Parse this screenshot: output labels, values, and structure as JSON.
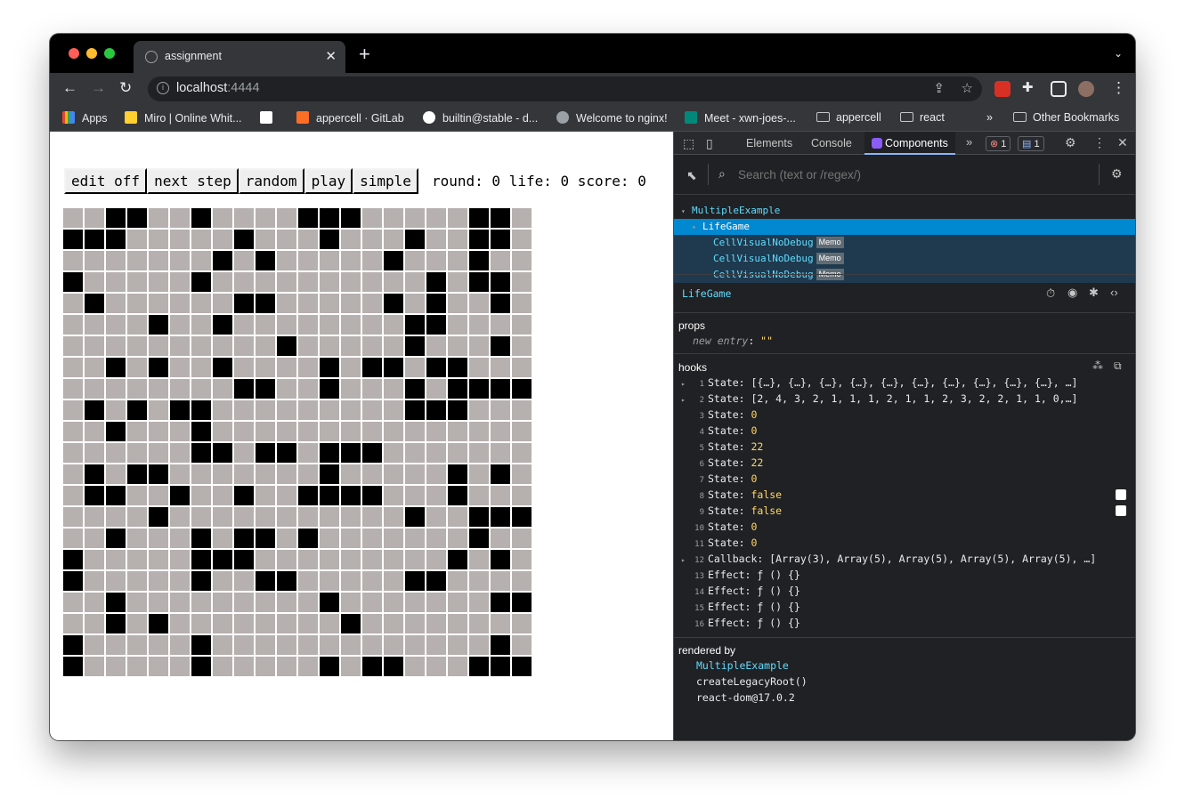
{
  "browser": {
    "tab_title": "assignment",
    "url_host": "localhost",
    "url_port": ":4444",
    "bookmarks": [
      {
        "label": "Apps",
        "icon": "apps-icon",
        "color": "#ea4335"
      },
      {
        "label": "Miro | Online Whit...",
        "icon": "miro-icon",
        "color": "#ffd02f"
      },
      {
        "label": "",
        "icon": "notion-icon",
        "color": "#ffffff"
      },
      {
        "label": "appercell · GitLab",
        "icon": "gitlab-icon",
        "color": "#fc6d26"
      },
      {
        "label": "builtin@stable - d...",
        "icon": "github-icon",
        "color": "#ffffff"
      },
      {
        "label": "Welcome to nginx!",
        "icon": "globe-icon",
        "color": "#9aa0a6"
      },
      {
        "label": "Meet - xwn-joes-...",
        "icon": "meet-icon",
        "color": "#00897b"
      },
      {
        "label": "appercell",
        "icon": "folder-icon",
        "color": "#c4c7c5"
      },
      {
        "label": "react",
        "icon": "folder-icon",
        "color": "#c4c7c5"
      }
    ],
    "overflow_label": "»",
    "other_bookmarks": "Other Bookmarks"
  },
  "game": {
    "buttons": [
      "edit off",
      "next step",
      "random",
      "play",
      "simple"
    ],
    "stats": "round: 0 life: 0 score: 0",
    "grid": [
      "0011001000011100000110",
      "1110000010001000100110",
      "0000000101000001000100",
      "1000001000000000010110",
      "0100000011000001010010",
      "0000100100000000110000",
      "0000000000100000100010",
      "0010100100001011011000",
      "0000000011001000101111",
      "0101011000000000111000",
      "0010001000000000000000",
      "0000001101101110000000",
      "0101100000001000001010",
      "0110010010011110001000",
      "0000100000000000100111",
      "0010001011010000000100",
      "1000001110000000001010",
      "1000001001100000110000",
      "0010000000001000000011",
      "0010100000000100000000",
      "1000001000000000000010",
      "1000001000001011000111"
    ]
  },
  "devtools": {
    "tabs": [
      "Elements",
      "Console",
      "Components"
    ],
    "active_tab": "Components",
    "error_count": "1",
    "message_count": "1",
    "search_placeholder": "Search (text or /regex/)",
    "tree": [
      {
        "name": "MultipleExample",
        "depth": 0,
        "memo": ""
      },
      {
        "name": "LifeGame",
        "depth": 1,
        "memo": ""
      },
      {
        "name": "CellVisualNoDebug",
        "depth": 2,
        "memo": "Memo"
      },
      {
        "name": "CellVisualNoDebug",
        "depth": 2,
        "memo": "Memo"
      },
      {
        "name": "CellVisualNoDebug",
        "depth": 2,
        "memo": "Memo"
      }
    ],
    "selected_component": "LifeGame",
    "props_title": "props",
    "new_entry_label": "new entry",
    "new_entry_value": "\"\"",
    "hooks_title": "hooks",
    "hooks": [
      {
        "idx": "1",
        "name": "State:",
        "value": "[{…}, {…}, {…}, {…}, {…}, {…}, {…}, {…}, {…}, {…}, …]",
        "kind": "obj",
        "expandable": true
      },
      {
        "idx": "2",
        "name": "State:",
        "value": "[2, 4, 3, 2, 1, 1, 1, 2, 1, 1, 2, 3, 2, 2, 1, 1, 0,…]",
        "kind": "obj",
        "expandable": true
      },
      {
        "idx": "3",
        "name": "State:",
        "value": "0",
        "kind": "num",
        "expandable": false
      },
      {
        "idx": "4",
        "name": "State:",
        "value": "0",
        "kind": "num",
        "expandable": false
      },
      {
        "idx": "5",
        "name": "State:",
        "value": "22",
        "kind": "num",
        "expandable": false
      },
      {
        "idx": "6",
        "name": "State:",
        "value": "22",
        "kind": "num",
        "expandable": false
      },
      {
        "idx": "7",
        "name": "State:",
        "value": "0",
        "kind": "num",
        "expandable": false
      },
      {
        "idx": "8",
        "name": "State:",
        "value": "false",
        "kind": "bool",
        "expandable": false,
        "checkbox": true
      },
      {
        "idx": "9",
        "name": "State:",
        "value": "false",
        "kind": "bool",
        "expandable": false,
        "checkbox": true
      },
      {
        "idx": "10",
        "name": "State:",
        "value": "0",
        "kind": "num",
        "expandable": false
      },
      {
        "idx": "11",
        "name": "State:",
        "value": "0",
        "kind": "num",
        "expandable": false
      },
      {
        "idx": "12",
        "name": "Callback:",
        "value": "[Array(3), Array(5), Array(5), Array(5), Array(5), …]",
        "kind": "obj",
        "expandable": true
      },
      {
        "idx": "13",
        "name": "Effect:",
        "value": "ƒ () {}",
        "kind": "obj",
        "expandable": false
      },
      {
        "idx": "14",
        "name": "Effect:",
        "value": "ƒ () {}",
        "kind": "obj",
        "expandable": false
      },
      {
        "idx": "15",
        "name": "Effect:",
        "value": "ƒ () {}",
        "kind": "obj",
        "expandable": false
      },
      {
        "idx": "16",
        "name": "Effect:",
        "value": "ƒ () {}",
        "kind": "obj",
        "expandable": false
      }
    ],
    "rendered_by_title": "rendered by",
    "rendered_by": [
      "MultipleExample",
      "createLegacyRoot()",
      "react-dom@17.0.2"
    ]
  }
}
